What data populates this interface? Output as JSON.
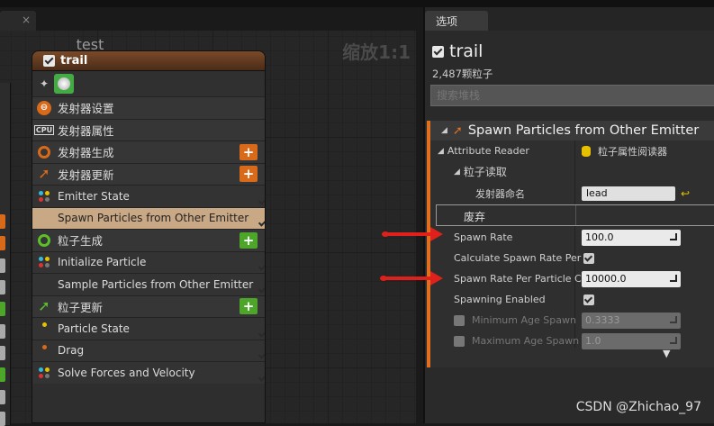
{
  "graph": {
    "title": "test",
    "zoom": "缩放1:1"
  },
  "node": {
    "title": "trail",
    "rows": [
      {
        "label": "发射器设置",
        "icon": "orange-gear-icon",
        "type": "section",
        "right": "none"
      },
      {
        "label": "发射器属性",
        "icon": "cpu-icon",
        "type": "section",
        "right": "none"
      },
      {
        "label": "发射器生成",
        "icon": "orange-ring-icon",
        "type": "section",
        "right": "plus-orange"
      },
      {
        "label": "发射器更新",
        "icon": "orange-arrow-icon",
        "type": "section",
        "right": "plus-orange"
      },
      {
        "label": "Emitter State",
        "icon": "dots-icon",
        "type": "module",
        "right": "check"
      },
      {
        "label": "Spawn Particles from Other Emitter",
        "icon": "none",
        "type": "highlight",
        "right": "check"
      },
      {
        "label": "粒子生成",
        "icon": "green-ring-icon",
        "type": "section",
        "right": "plus-green"
      },
      {
        "label": "Initialize Particle",
        "icon": "dots-icon",
        "type": "module",
        "right": "check"
      },
      {
        "label": "Sample Particles from Other Emitter",
        "icon": "none",
        "type": "module",
        "right": "check"
      },
      {
        "label": "粒子更新",
        "icon": "green-arrow-icon",
        "type": "section",
        "right": "plus-green"
      },
      {
        "label": "Particle State",
        "icon": "yellow-dot-icon",
        "type": "module",
        "right": "check"
      },
      {
        "label": "Drag",
        "icon": "orange-dot-icon",
        "type": "module",
        "right": "check"
      },
      {
        "label": "Solve Forces and Velocity",
        "icon": "dots-icon",
        "type": "module",
        "right": "check"
      }
    ]
  },
  "panel": {
    "tab": "选项",
    "emitter_name": "trail",
    "particle_count": "2,487颗粒子",
    "search_placeholder": "搜索堆栈",
    "module_title": "Spawn Particles from Other Emitter",
    "attribute_reader_label": "Attribute Reader",
    "attribute_reader_value": "粒子属性阅读器",
    "particle_read_label": "粒子读取",
    "emitter_name_label": "发射器命名",
    "emitter_name_value": "lead",
    "deprecated_label": "废弃",
    "spawn_rate_label": "Spawn Rate",
    "spawn_rate_value": "100.0",
    "calc_spawn_rate_label": "Calculate Spawn Rate Per",
    "spawn_rate_per_particle_label": "Spawn Rate Per Particle C",
    "spawn_rate_per_particle_value": "10000.0",
    "spawning_enabled_label": "Spawning Enabled",
    "min_age_label": "Minimum Age Spawn",
    "min_age_value": "0.3333",
    "max_age_label": "Maximum Age Spawn",
    "max_age_value": "1.0"
  },
  "watermark": "CSDN @Zhichao_97",
  "colors": {
    "accent_orange": "#e07020",
    "node_header": "#7a4a28",
    "highlight_row": "#c9a885",
    "annotation_red": "#e0201a",
    "plus_green": "#4da52a"
  }
}
